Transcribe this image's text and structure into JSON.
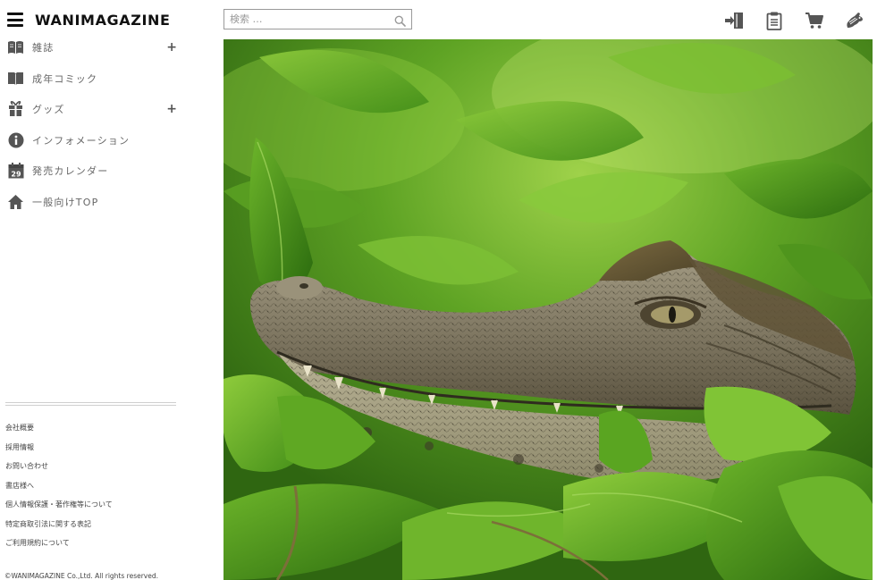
{
  "brand": {
    "logo_text": "WANIMAGAZINE"
  },
  "search": {
    "placeholder": "検索 …"
  },
  "sidebar": {
    "items": [
      {
        "label": "雑誌",
        "icon": "book-open-icon",
        "expandable": true
      },
      {
        "label": "成年コミック",
        "icon": "book-icon",
        "expandable": false
      },
      {
        "label": "グッズ",
        "icon": "gift-icon",
        "expandable": true
      },
      {
        "label": "インフォメーション",
        "icon": "info-icon",
        "expandable": false
      },
      {
        "label": "発売カレンダー",
        "icon": "calendar-icon",
        "expandable": false
      },
      {
        "label": "一般向けTOP",
        "icon": "home-icon",
        "expandable": false
      }
    ],
    "calendar_day": "29",
    "expand_symbol": "+"
  },
  "footer": {
    "links": [
      "会社概要",
      "採用情報",
      "お問い合わせ",
      "書店様へ",
      "個人情報保護・著作権等について",
      "特定商取引法に関する表記",
      "ご利用規約について"
    ],
    "copyright": "©WANIMAGAZINE Co.,Ltd. All rights reserved."
  },
  "header": {
    "icons": [
      "login-icon",
      "document-icon",
      "cart-icon",
      "crocodile-logo-icon"
    ]
  },
  "hero": {
    "subject": "crocodile-in-leaves-photo"
  },
  "colors": {
    "text": "#666666",
    "icon_gray": "#555555",
    "logo": "#111111",
    "leaf_green": "#4a9a1e",
    "croc_gray": "#8a8470"
  }
}
